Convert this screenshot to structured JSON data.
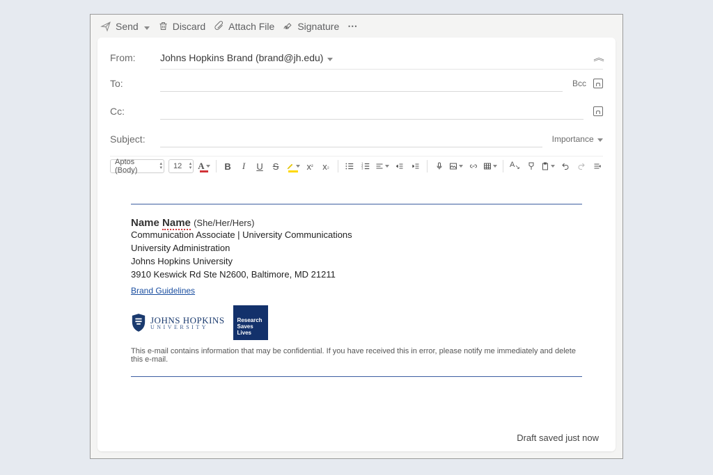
{
  "toolbar": {
    "send": "Send",
    "discard": "Discard",
    "attach": "Attach File",
    "signature": "Signature"
  },
  "fields": {
    "from_label": "From:",
    "from_value": "Johns Hopkins Brand (brand@jh.edu)",
    "to_label": "To:",
    "cc_label": "Cc:",
    "subject_label": "Subject:",
    "bcc": "Bcc",
    "importance": "Importance"
  },
  "format": {
    "font": "Aptos (Body)",
    "size": "12"
  },
  "signature": {
    "name_first": "Name",
    "name_last": "Name",
    "pronouns": "(She/Her/Hers)",
    "title_line": "Communication Associate | University Communications",
    "division": "University Administration",
    "org": "Johns Hopkins University",
    "address": "3910 Keswick Rd Ste N2600, Baltimore, MD 21211",
    "link_label": "Brand Guidelines",
    "logo_uni_top": "JOHNS HOPKINS",
    "logo_uni_bot": "UNIVERSITY",
    "rsl_l1": "Research",
    "rsl_l2": "Saves",
    "rsl_l3": "Lives",
    "disclaimer": "This e-mail contains information that may be confidential. If you have received this in error, please notify me immediately and delete this e-mail."
  },
  "status": {
    "draft": "Draft saved just now"
  }
}
